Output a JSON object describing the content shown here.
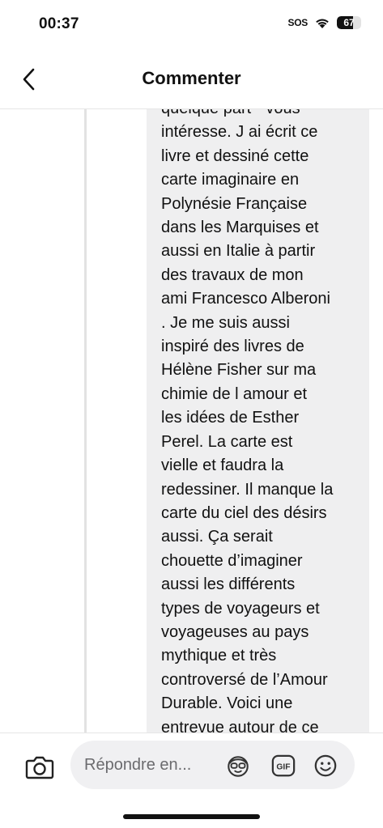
{
  "status_bar": {
    "time": "00:37",
    "sos": "SOS",
    "battery_level": "67",
    "battery_percent": 67
  },
  "header": {
    "title": "Commenter",
    "back_icon": "chevron-left-icon"
  },
  "comment": {
    "lines": [
      "quelque part \" vous",
      "intéresse. J ai écrit ce",
      "livre et dessiné cette",
      "carte imaginaire en",
      "Polynésie Française",
      "dans les Marquises et",
      "aussi en Italie à partir",
      "des travaux de mon",
      "ami Francesco Alberoni",
      ". Je me suis aussi",
      "inspiré des livres de",
      "Hélène Fisher sur ma",
      "chimie de l amour et",
      "les idées de Esther",
      "Perel. La carte est",
      "vielle et faudra la",
      "redessiner. Il manque la",
      "carte du ciel des désirs",
      "aussi. Ça serait",
      "chouette d’imaginer",
      "aussi les différents",
      "types de voyageurs et",
      "voyageuses au pays",
      "mythique et très",
      "controversé de l’Amour",
      "Durable. Voici une",
      "entrevue autour de ce"
    ]
  },
  "reply_bar": {
    "placeholder": "Répondre en...",
    "icons": [
      "camera-icon",
      "avatar-sticker-icon",
      "gif-icon",
      "emoji-icon"
    ]
  },
  "colors": {
    "bubble": "#efeff0",
    "thread_line": "#e2e2e2",
    "field": "#f0f0f2",
    "text": "#111111"
  }
}
